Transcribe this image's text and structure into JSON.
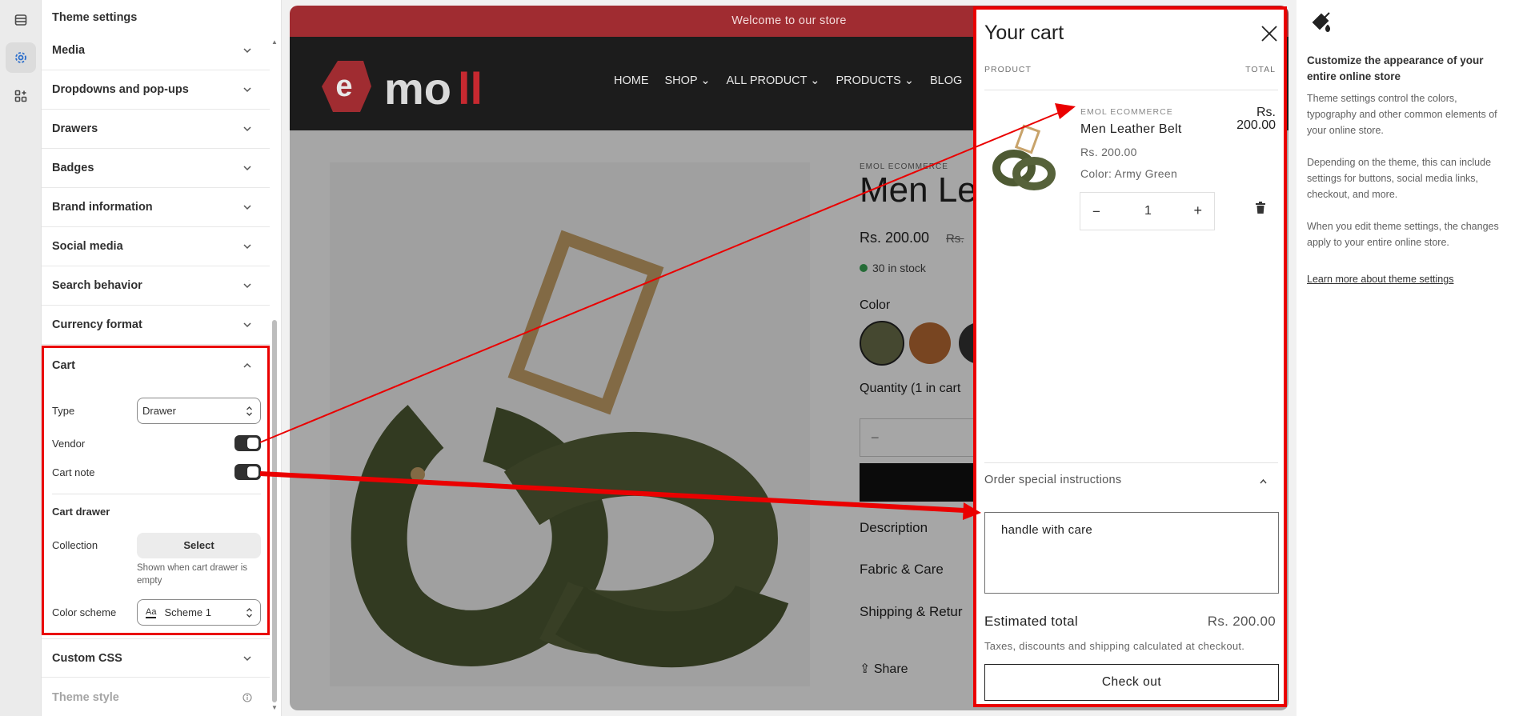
{
  "sidebar": {
    "title": "Theme settings",
    "sections": [
      {
        "label": "Media"
      },
      {
        "label": "Dropdowns and pop-ups"
      },
      {
        "label": "Drawers"
      },
      {
        "label": "Badges"
      },
      {
        "label": "Brand information"
      },
      {
        "label": "Social media"
      },
      {
        "label": "Search behavior"
      },
      {
        "label": "Currency format"
      }
    ],
    "cart": {
      "label": "Cart",
      "type_label": "Type",
      "type_value": "Drawer",
      "vendor_label": "Vendor",
      "vendor_on": true,
      "cart_note_label": "Cart note",
      "cart_note_on": true,
      "cart_drawer_heading": "Cart drawer",
      "collection_label": "Collection",
      "collection_button": "Select",
      "collection_help": "Shown when cart drawer is empty",
      "color_scheme_label": "Color scheme",
      "color_scheme_value": "Scheme 1",
      "color_scheme_icon_text": "Aa"
    },
    "custom_css": "Custom CSS",
    "theme_style": "Theme style"
  },
  "store": {
    "announcement": "Welcome to our store",
    "logo_text": "e moll",
    "nav": [
      "HOME",
      "SHOP",
      "ALL PRODUCT",
      "PRODUCTS",
      "BLOG"
    ],
    "product": {
      "vendor": "EMOL ECOMMERCE",
      "title": "Men Le",
      "price": "Rs. 200.00",
      "compare_price": "Rs.",
      "stock": "30 in stock",
      "color_label": "Color",
      "quantity_label": "Quantity (1 in cart",
      "accordions": [
        "Description",
        "Fabric & Care",
        "Shipping & Retur"
      ],
      "share": "Share"
    }
  },
  "cart_drawer": {
    "title": "Your cart",
    "col_product": "PRODUCT",
    "col_total": "TOTAL",
    "item": {
      "vendor": "EMOL ECOMMERCE",
      "name": "Men Leather Belt",
      "price": "Rs. 200.00",
      "color": "Color: Army Green",
      "quantity": "1",
      "total_line1": "Rs.",
      "total_line2": "200.00"
    },
    "special_instructions_label": "Order special instructions",
    "note_text": "handle with care",
    "estimated_total_label": "Estimated total",
    "estimated_total_value": "Rs. 200.00",
    "tax_note": "Taxes, discounts and shipping calculated at checkout.",
    "checkout_label": "Check out"
  },
  "info_panel": {
    "heading": "Customize the appearance of your entire online store",
    "p1": "Theme settings control the colors, typography and other common elements of your online store.",
    "p2": "Depending on the theme, this can include settings for buttons, social media links, checkout, and more.",
    "p3": "When you edit theme settings, the changes apply to your entire online store.",
    "link": "Learn more about theme settings"
  },
  "colors": {
    "accent_red": "#ea0000",
    "announcement_bg": "#a02c31",
    "header_bg": "#1c1c1c",
    "belt_green": "#4e5a33"
  }
}
